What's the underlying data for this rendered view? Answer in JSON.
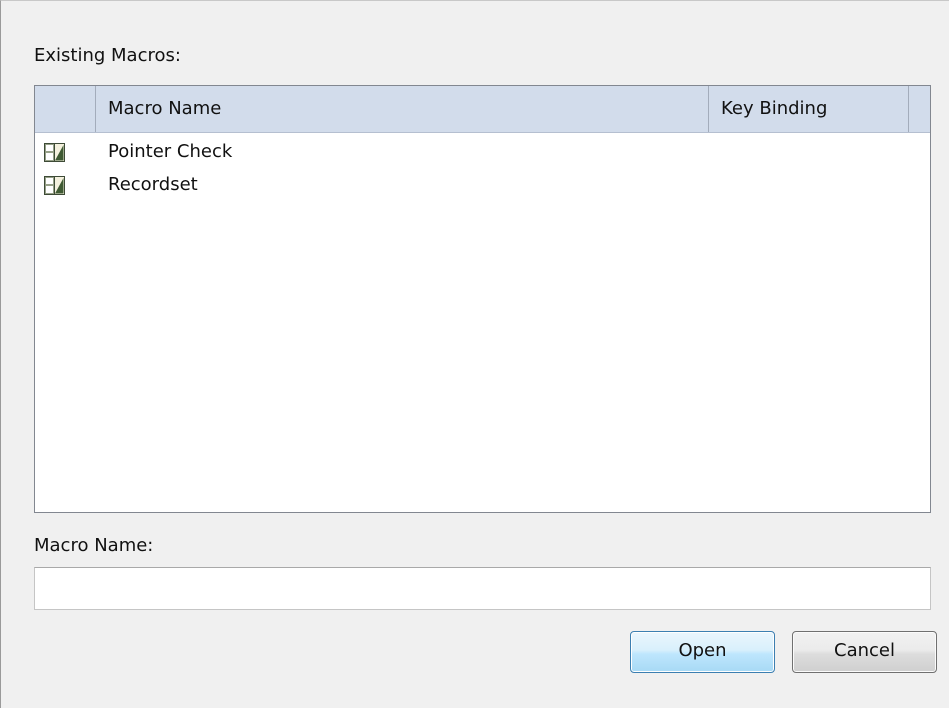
{
  "dialog": {
    "existing_label": "Existing Macros:",
    "list": {
      "columns": [
        "",
        "Macro Name",
        "Key Binding"
      ],
      "rows": [
        {
          "icon": "macro-icon",
          "name": "Pointer Check",
          "key_binding": ""
        },
        {
          "icon": "macro-icon",
          "name": "Recordset",
          "key_binding": ""
        }
      ]
    },
    "macro_name_label": "Macro Name:",
    "macro_name_value": "",
    "buttons": {
      "open": "Open",
      "cancel": "Cancel"
    }
  },
  "colors": {
    "header_bg": "#d2dceb",
    "dialog_bg": "#f0f0f0",
    "default_button_border": "#3c7fb1"
  }
}
